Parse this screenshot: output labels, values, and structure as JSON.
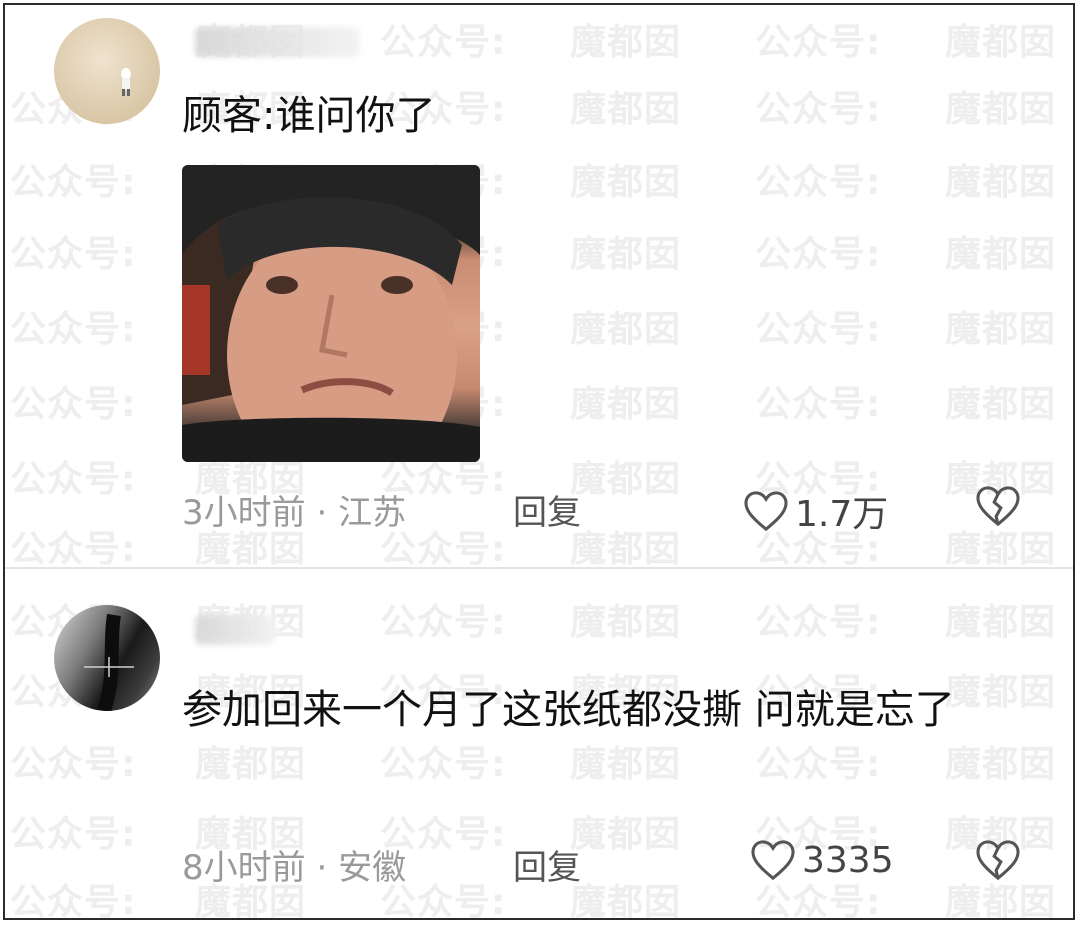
{
  "watermark": {
    "brand": "公众号:",
    "site": "魔都囡"
  },
  "comments": [
    {
      "text": "顾客:谁问你了",
      "has_image": true,
      "time": "3小时前",
      "location": "江苏",
      "reply_label": "回复",
      "likes": "1.7万"
    },
    {
      "text": "参加回来一个月了这张纸都没撕 问就是忘了",
      "has_image": false,
      "time": "8小时前",
      "location": "安徽",
      "reply_label": "回复",
      "likes": "3335"
    }
  ],
  "icons": {
    "like": "heart-outline-icon",
    "dislike": "broken-heart-icon"
  },
  "colors": {
    "text": "#111111",
    "meta": "#9a9a9a",
    "watermark": "#eeeeee"
  }
}
